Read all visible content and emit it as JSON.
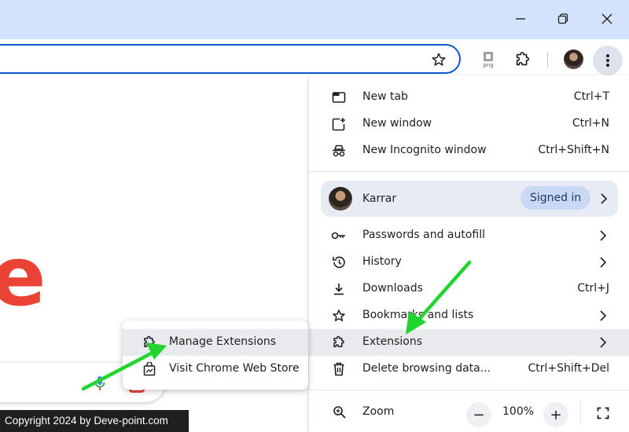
{
  "window": {
    "minimize_icon": "minimize-icon",
    "restore_icon": "restore-icon",
    "close_icon": "close-icon"
  },
  "toolbar": {
    "bookmark_icon": "star-icon",
    "extension_icon": "png-extension-icon",
    "extensions_icon": "puzzle-icon",
    "menu_icon": "vertical-dots-icon"
  },
  "page": {
    "partial_logo_letter": "e"
  },
  "menu": {
    "items_top": [
      {
        "label": "New tab",
        "shortcut": "Ctrl+T",
        "icon": "new-tab-icon"
      },
      {
        "label": "New window",
        "shortcut": "Ctrl+N",
        "icon": "new-window-icon"
      },
      {
        "label": "New Incognito window",
        "shortcut": "Ctrl+Shift+N",
        "icon": "incognito-icon"
      }
    ],
    "profile": {
      "name": "Karrar",
      "status": "Signed in"
    },
    "items_mid": [
      {
        "label": "Passwords and autofill",
        "shortcut": "",
        "icon": "key-icon",
        "submenu": true
      },
      {
        "label": "History",
        "shortcut": "",
        "icon": "history-icon",
        "submenu": true
      },
      {
        "label": "Downloads",
        "shortcut": "Ctrl+J",
        "icon": "download-icon",
        "submenu": false
      },
      {
        "label": "Bookmarks and lists",
        "shortcut": "",
        "icon": "star-icon",
        "submenu": true
      },
      {
        "label": "Extensions",
        "shortcut": "",
        "icon": "puzzle-icon",
        "submenu": true
      },
      {
        "label": "Delete browsing data...",
        "shortcut": "Ctrl+Shift+Del",
        "icon": "trash-icon",
        "submenu": false
      }
    ],
    "zoom": {
      "label": "Zoom",
      "minus": "−",
      "value": "100%",
      "plus": "+"
    }
  },
  "submenu": {
    "items": [
      {
        "label": "Manage Extensions",
        "icon": "puzzle-icon"
      },
      {
        "label": "Visit Chrome Web Store",
        "icon": "web-store-icon"
      }
    ]
  },
  "colors": {
    "titlebar": "#d3e3fd",
    "focus_border": "#0b57d0",
    "hover": "#e9eaee",
    "signed_in_pill": "#c9d9f5",
    "arrow": "#22d42e",
    "logo_red": "#ea4335"
  },
  "copyright": "Copyright 2024 by Deve-point.com"
}
